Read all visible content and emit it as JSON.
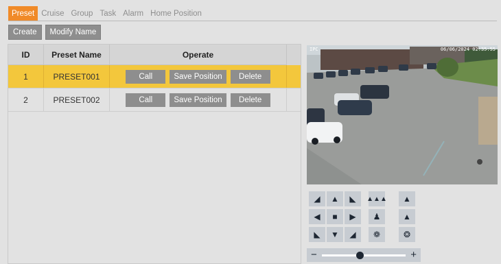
{
  "tabs": [
    {
      "label": "Preset",
      "active": true
    },
    {
      "label": "Cruise",
      "active": false
    },
    {
      "label": "Group",
      "active": false
    },
    {
      "label": "Task",
      "active": false
    },
    {
      "label": "Alarm",
      "active": false
    },
    {
      "label": "Home Position",
      "active": false
    }
  ],
  "toolbar": {
    "create_label": "Create",
    "modify_label": "Modify Name"
  },
  "table": {
    "headers": {
      "id": "ID",
      "name": "Preset Name",
      "operate": "Operate"
    },
    "rows": [
      {
        "id": "1",
        "name": "PRESET001",
        "selected": true
      },
      {
        "id": "2",
        "name": "PRESET002",
        "selected": false
      }
    ],
    "actions": {
      "call": "Call",
      "save": "Save Position",
      "delete": "Delete"
    }
  },
  "video": {
    "osd_left": "IPC",
    "osd_right": "06/06/2024 02:35:55"
  },
  "ptz": {
    "icons": [
      "up-left-arrow-icon",
      "up-arrow-icon",
      "up-right-arrow-icon",
      "left-arrow-icon",
      "stop-icon",
      "right-arrow-icon",
      "down-left-arrow-icon",
      "down-arrow-icon",
      "down-right-arrow-icon",
      "zoom-out-scene-icon",
      "zoom-in-scene-icon",
      "focus-near-icon",
      "focus-far-icon",
      "iris-open-icon",
      "iris-close-icon"
    ],
    "zoom_level": 0.45
  },
  "colors": {
    "accent": "#f08a28",
    "selected_row": "#f3c73c",
    "button": "#8e8e8e",
    "ptz_button": "#c7ccd2"
  }
}
